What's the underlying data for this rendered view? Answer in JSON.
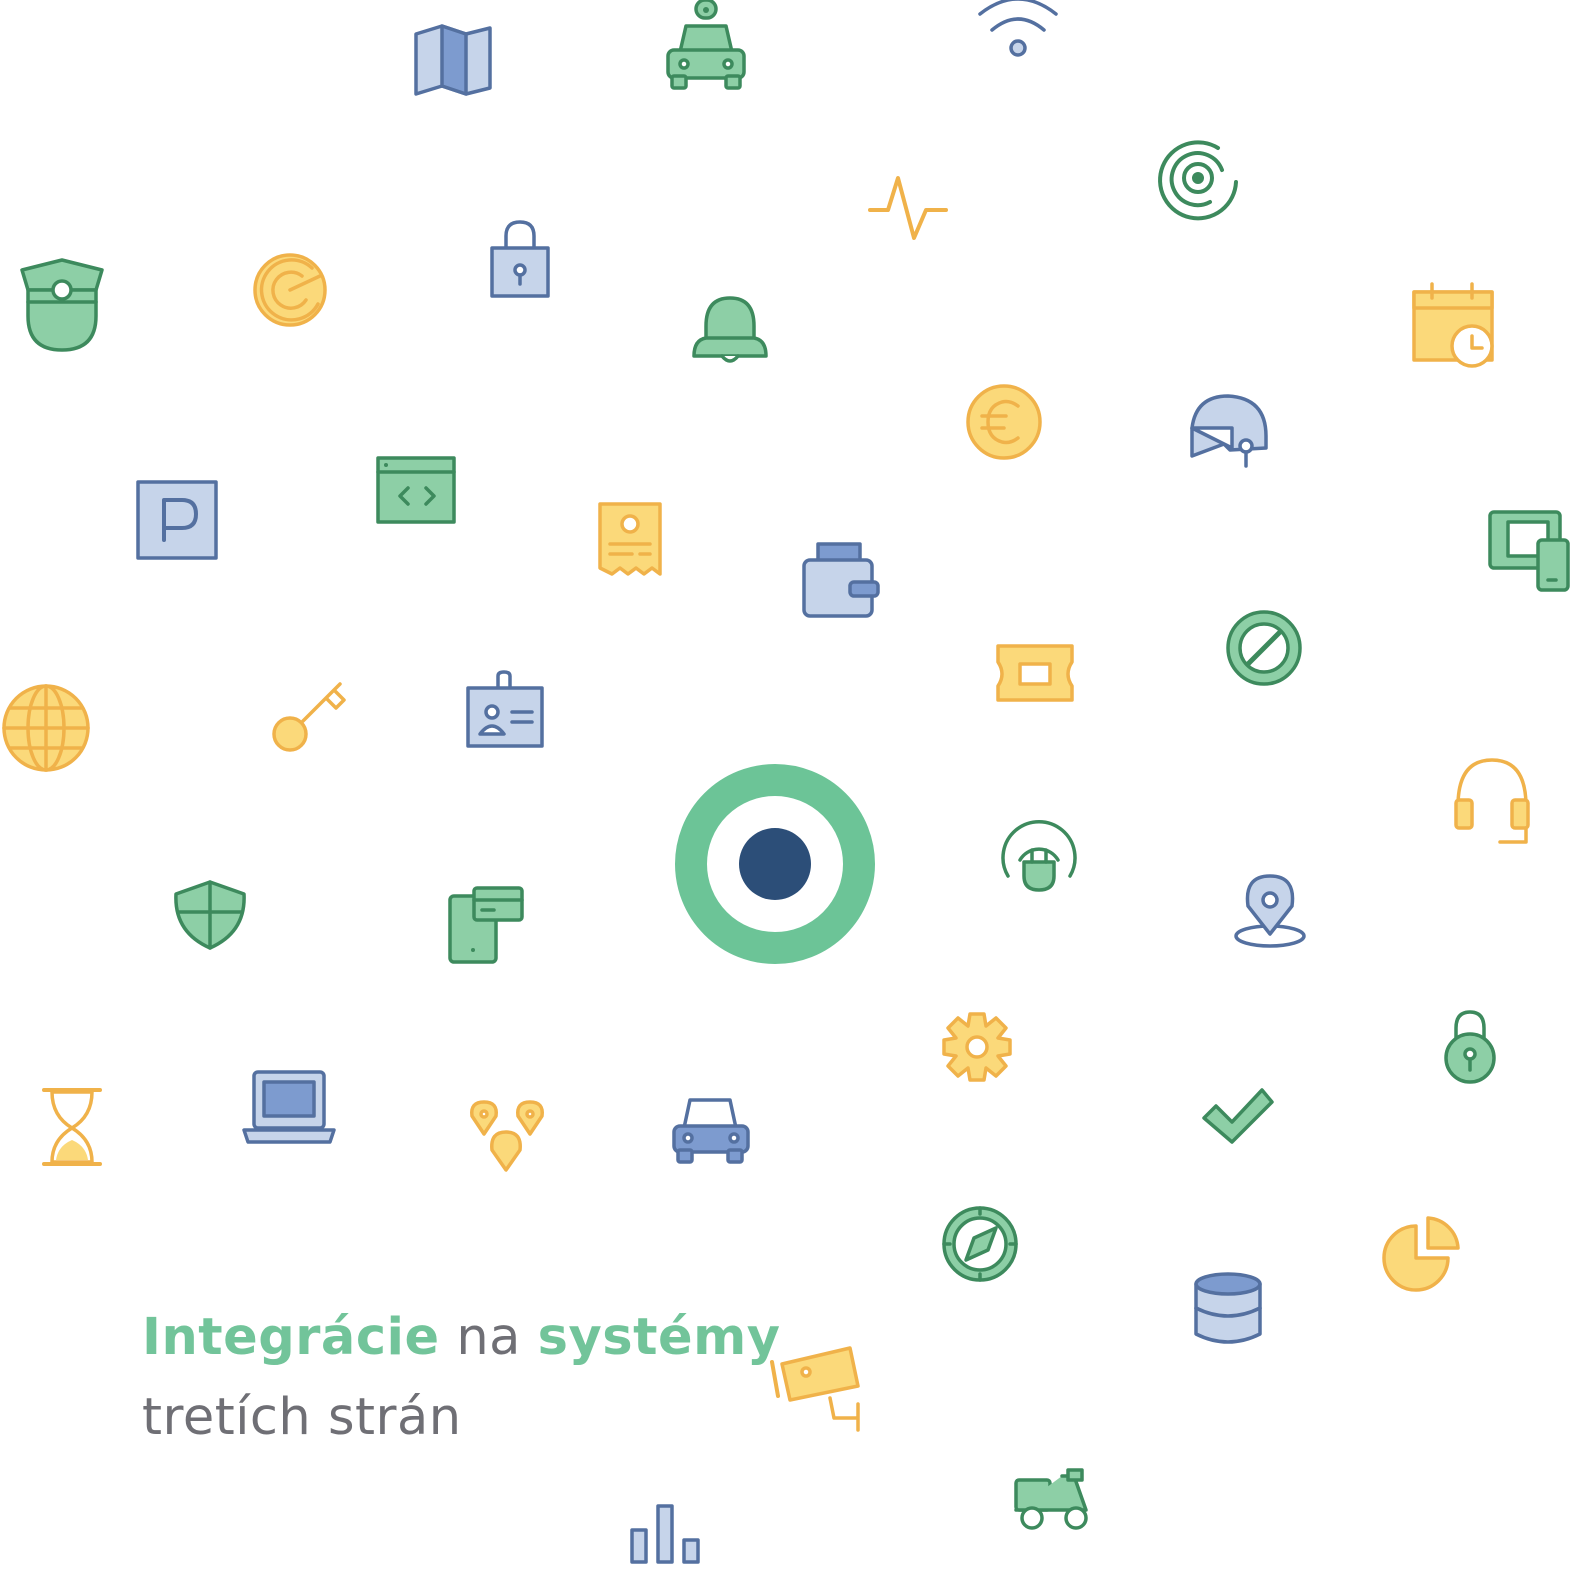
{
  "heading": {
    "word1": "Integrácie",
    "word2": "na",
    "word3": "systémy",
    "line2": "tretích strán"
  },
  "colors": {
    "green_fill": "#8dcfa6",
    "green_stroke": "#3d8a5d",
    "blue_fill": "#c6d4ea",
    "blue_mid": "#7d9bcf",
    "blue_stroke": "#5470a0",
    "yellow_fill": "#fbd97a",
    "yellow_stroke": "#f0b24a",
    "heading_accent": "#72c49a",
    "heading_text": "#6f6f75",
    "center_ring": "#6cc497",
    "center_dot": "#2c4e78"
  },
  "icons": [
    "map-icon",
    "robot-car-icon",
    "wifi-icon",
    "pulse-icon",
    "fingerprint-target-icon",
    "police-cap-icon",
    "target-coin-icon",
    "padlock-icon",
    "bell-icon",
    "calendar-clock-icon",
    "euro-coin-icon",
    "helmet-icon",
    "parking-sign-icon",
    "code-window-icon",
    "receipt-icon",
    "wallet-icon",
    "devices-icon",
    "no-entry-icon",
    "ticket-icon",
    "globe-icon",
    "key-icon",
    "id-badge-icon",
    "center-target-icon",
    "ev-plug-icon",
    "headset-icon",
    "shield-icon",
    "phone-card-icon",
    "location-pin-icon",
    "gear-icon",
    "round-padlock-icon",
    "hourglass-icon",
    "laptop-icon",
    "multi-pin-icon",
    "car-icon",
    "checkmark-icon",
    "compass-icon",
    "pie-chart-icon",
    "database-icon",
    "security-camera-icon",
    "bar-chart-icon",
    "scooter-icon"
  ]
}
